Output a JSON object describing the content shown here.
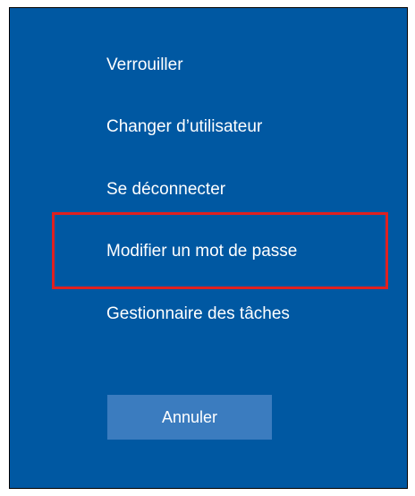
{
  "menu": {
    "items": [
      {
        "label": "Verrouiller"
      },
      {
        "label": "Changer d’utilisateur"
      },
      {
        "label": "Se déconnecter"
      },
      {
        "label": "Modifier un mot de passe"
      },
      {
        "label": "Gestionnaire des tâches"
      }
    ]
  },
  "actions": {
    "cancel_label": "Annuler"
  },
  "colors": {
    "background": "#0058a2",
    "highlight": "#e02020",
    "button": "#3b7cbf",
    "text": "#ffffff"
  }
}
